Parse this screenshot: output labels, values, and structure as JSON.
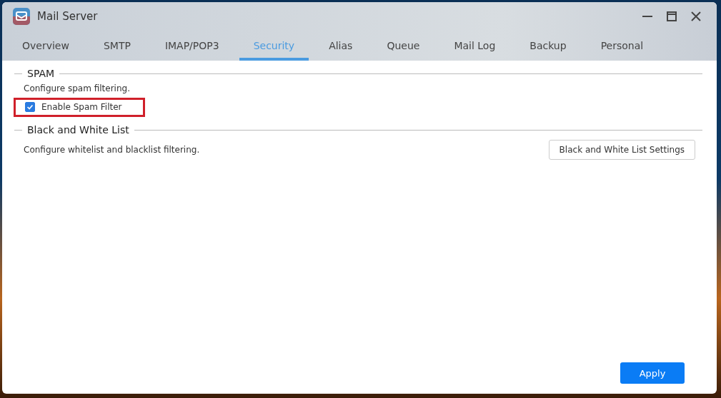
{
  "window": {
    "title": "Mail Server"
  },
  "tabs": [
    {
      "label": "Overview",
      "selected": false
    },
    {
      "label": "SMTP",
      "selected": false
    },
    {
      "label": "IMAP/POP3",
      "selected": false
    },
    {
      "label": "Security",
      "selected": true
    },
    {
      "label": "Alias",
      "selected": false
    },
    {
      "label": "Queue",
      "selected": false
    },
    {
      "label": "Mail Log",
      "selected": false
    },
    {
      "label": "Backup",
      "selected": false
    },
    {
      "label": "Personal",
      "selected": false
    }
  ],
  "sections": [
    {
      "title": "SPAM",
      "description": "Configure spam filtering.",
      "checkbox": {
        "label": "Enable Spam Filter",
        "checked": true,
        "highlighted": true
      }
    },
    {
      "title": "Black and White List",
      "description": "Configure whitelist and blacklist filtering.",
      "button": "Black and White List Settings"
    }
  ],
  "apply_button": "Apply"
}
